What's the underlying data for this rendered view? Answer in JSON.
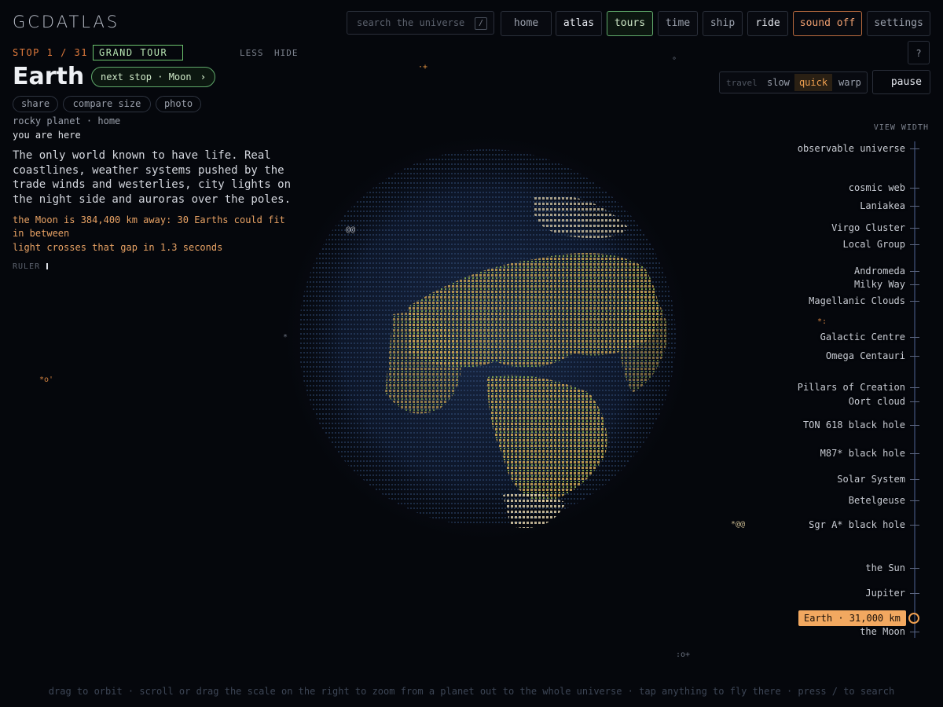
{
  "app": {
    "title": "GCDATLAS"
  },
  "search": {
    "placeholder": "search the universe",
    "shortcut": "/"
  },
  "nav": [
    {
      "label": "home"
    },
    {
      "label": "atlas"
    },
    {
      "label": "tours"
    },
    {
      "label": "time"
    },
    {
      "label": "ship"
    },
    {
      "label": "ride"
    },
    {
      "label": "sound off"
    },
    {
      "label": "settings"
    }
  ],
  "help": "?",
  "tour": {
    "stop": "STOP 1 / 31",
    "name": "GRAND TOUR",
    "less": "LESS",
    "hide": "HIDE"
  },
  "object": {
    "name": "Earth",
    "next_stop": "next stop · Moon",
    "next_icon": "›",
    "actions": [
      {
        "label": "share"
      },
      {
        "label": "compare size"
      },
      {
        "label": "photo"
      }
    ],
    "meta": "rocky planet · home",
    "status": "you are here",
    "description": "The only world known to have life. Real coastlines, weather systems pushed by the trade winds and westerlies, city lights on the night side and auroras over the poles.",
    "fact_1": "the Moon is 384,400 km away: 30 Earths could fit in between",
    "fact_2": "light crosses that gap in 1.3 seconds",
    "ruler": "RULER"
  },
  "speed": {
    "label": "travel",
    "options": [
      "slow",
      "quick",
      "warp"
    ],
    "selected": "quick",
    "pause": "pause"
  },
  "scale": {
    "title": "VIEW WIDTH",
    "current": "Earth · 31,000 km",
    "items": [
      "observable universe",
      "cosmic web",
      "Laniakea",
      "Virgo Cluster",
      "Local Group",
      "Andromeda",
      "Milky Way",
      "Magellanic Clouds",
      "Galactic Centre",
      "Omega Centauri",
      "Pillars of Creation",
      "Oort cloud",
      "TON 618 black hole",
      "M87* black hole",
      "Solar System",
      "Betelgeuse",
      "Sgr A* black hole",
      "the Sun",
      "Jupiter",
      "the Moon"
    ]
  },
  "footer": "drag to orbit · scroll or drag the scale on the right to zoom from a planet out to the whole universe · tap anything to fly there · press / to search",
  "colors": {
    "accent_green": "#6cc46e",
    "accent_orange": "#f0a050",
    "sound_red": "#b86a3e",
    "background": "#05070c"
  }
}
